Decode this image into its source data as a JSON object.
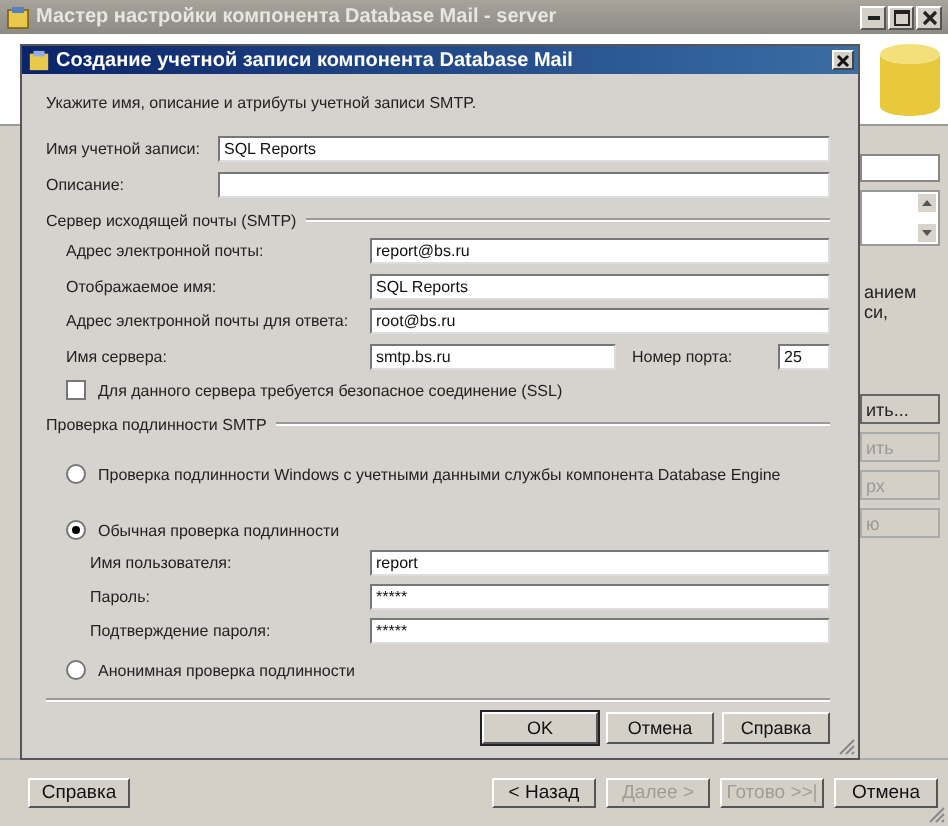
{
  "window": {
    "title": "Мастер настройки компонента Database Mail - server"
  },
  "background": {
    "texts": [
      "анием",
      "си,"
    ],
    "buttons": [
      {
        "label": "ить...",
        "disabled": false
      },
      {
        "label": "ить",
        "disabled": true
      },
      {
        "label": "рх",
        "disabled": true
      },
      {
        "label": "ю",
        "disabled": true
      }
    ]
  },
  "dialog": {
    "title": "Создание учетной записи компонента Database Mail",
    "instruction": "Укажите имя, описание и атрибуты учетной записи SMTP.",
    "account_fields": [
      {
        "label": "Имя учетной записи:",
        "value": "SQL Reports"
      },
      {
        "label": "Описание:"
      }
    ],
    "smtp_section": "Сервер исходящей почты (SMTP)",
    "smtp_fields": [
      {
        "label": "Адрес электронной почты:",
        "value": "report@bs.ru"
      },
      {
        "label": "Отображаемое имя:",
        "value": "SQL Reports"
      },
      {
        "label": "Адрес электронной почты для ответа:",
        "value": "root@bs.ru"
      }
    ],
    "server": {
      "label": "Имя сервера:",
      "value": "smtp.bs.ru"
    },
    "port": {
      "label": "Номер порта:",
      "value": "25"
    },
    "ssl": {
      "label": "Для данного сервера требуется безопасное соединение (SSL)",
      "checked": false
    },
    "auth_section": "Проверка подлинности SMTP",
    "auth_options": [
      {
        "label": "Проверка подлинности Windows с учетными данными службы компонента Database Engine",
        "selected": false
      },
      {
        "label": "Обычная проверка подлинности",
        "selected": true,
        "fields": [
          {
            "label": "Имя пользователя:",
            "value": "report"
          },
          {
            "label": "Пароль:",
            "value": "*****"
          },
          {
            "label": "Подтверждение пароля:",
            "value": "*****"
          }
        ]
      },
      {
        "label": "Анонимная проверка подлинности",
        "selected": false
      }
    ],
    "buttons": [
      {
        "label": "OK",
        "default": true
      },
      {
        "label": "Отмена",
        "default": false
      },
      {
        "label": "Справка",
        "default": false
      }
    ]
  },
  "footer": {
    "help": {
      "label": "Справка",
      "disabled": false
    },
    "buttons": [
      {
        "label": "< Назад",
        "disabled": false
      },
      {
        "label": "Далее >",
        "disabled": true
      },
      {
        "label": "Готово >>|",
        "disabled": true
      },
      {
        "label": "Отмена",
        "disabled": false
      }
    ]
  }
}
